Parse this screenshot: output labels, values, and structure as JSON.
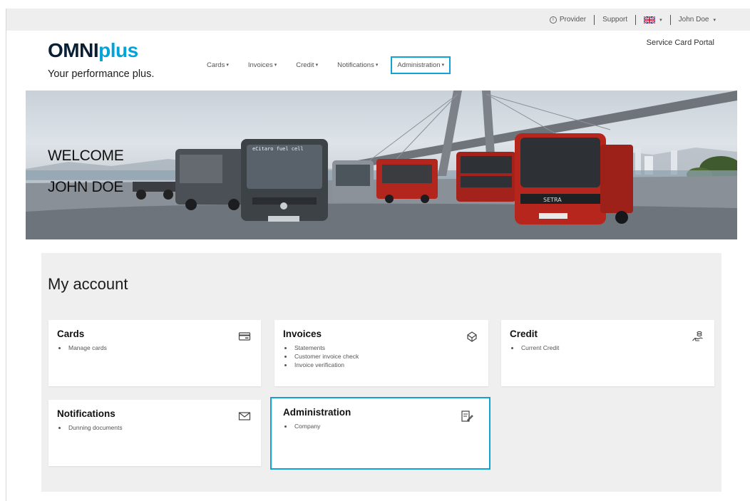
{
  "util_bar": {
    "provider_label": "Provider",
    "support_label": "Support",
    "language_flag": "uk-flag-icon",
    "user_name": "John Doe"
  },
  "header": {
    "logo_omni": "OMNI",
    "logo_plus": "plus",
    "tagline": "Your performance plus.",
    "portal_name": "Service Card Portal"
  },
  "nav": {
    "items": [
      {
        "label": "Cards"
      },
      {
        "label": "Invoices"
      },
      {
        "label": "Credit"
      },
      {
        "label": "Notifications"
      },
      {
        "label": "Administration"
      }
    ],
    "active": "Administration"
  },
  "hero": {
    "line1": "WELCOME",
    "line2": "JOHN DOE",
    "bus_label": "eCitaro fuel cell",
    "setra_label": "SETRA"
  },
  "account": {
    "title": "My account",
    "cards": [
      {
        "title": "Cards",
        "icon": "credit-card-icon",
        "items": [
          "Manage cards"
        ]
      },
      {
        "title": "Invoices",
        "icon": "invoice-box-icon",
        "items": [
          "Statements",
          "Customer invoice check",
          "Invoice verification"
        ]
      },
      {
        "title": "Credit",
        "icon": "hand-coins-icon",
        "items": [
          "Current Credit"
        ]
      },
      {
        "title": "Notifications",
        "icon": "envelope-icon",
        "items": [
          "Dunning documents"
        ]
      },
      {
        "title": "Administration",
        "icon": "edit-document-icon",
        "items": [
          "Company"
        ]
      }
    ]
  },
  "colors": {
    "accent": "#10a4d4",
    "logo_dark": "#0a1f33",
    "logo_blue": "#00a4d9",
    "panel_bg": "#efefef"
  }
}
